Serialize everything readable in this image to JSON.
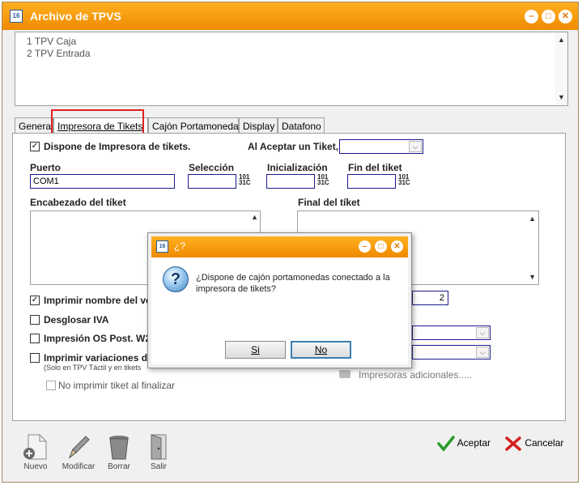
{
  "window": {
    "title": "Archivo de TPVS"
  },
  "list": {
    "items": [
      "1 TPV Caja",
      "2 TPV Entrada"
    ]
  },
  "tabs": [
    {
      "label": "General"
    },
    {
      "label": "Impresora de Tikets"
    },
    {
      "label": "Cajón Portamonedas"
    },
    {
      "label": "Display"
    },
    {
      "label": "Datafono"
    }
  ],
  "form": {
    "dispone_impresora": "Dispone de Impresora de tikets.",
    "al_aceptar": "Al Aceptar un Tiket,",
    "puerto_label": "Puerto",
    "puerto_value": "COM1",
    "seleccion_label": "Selección",
    "inicializacion_label": "Inicialización",
    "fin_label": "Fin del tiket",
    "calc_top": "101",
    "calc_bottom": "31C",
    "encabezado_label": "Encabezado del tíket",
    "final_label": "Final del tíket",
    "imprimir_nombre": "Imprimir nombre del ve",
    "copias_value": "2",
    "desglosar_iva": "Desglosar IVA",
    "impresion_os": "Impresión OS Post. W2",
    "imprimir_variaciones": "Imprimir variaciones d",
    "solo_tpv": "(Solo en TPV Táctil y en tikets",
    "no_imprimir": "No imprimir tiket al finalizar",
    "impresoras_adicionales": "Impresoras adicionales....."
  },
  "toolbar": {
    "nuevo": "Nuevo",
    "modificar": "Modificar",
    "borrar": "Borrar",
    "salir": "Salir"
  },
  "actions": {
    "aceptar": "Aceptar",
    "cancelar": "Cancelar"
  },
  "dialog": {
    "title": "¿?",
    "message": "¿Dispone de cajón portamonedas conectado a la impresora de tikets?",
    "yes": "Si",
    "no": "No"
  },
  "colors": {
    "title_bar": "#f08a00",
    "field_border": "#1a1a8c",
    "highlight": "#e02020"
  }
}
